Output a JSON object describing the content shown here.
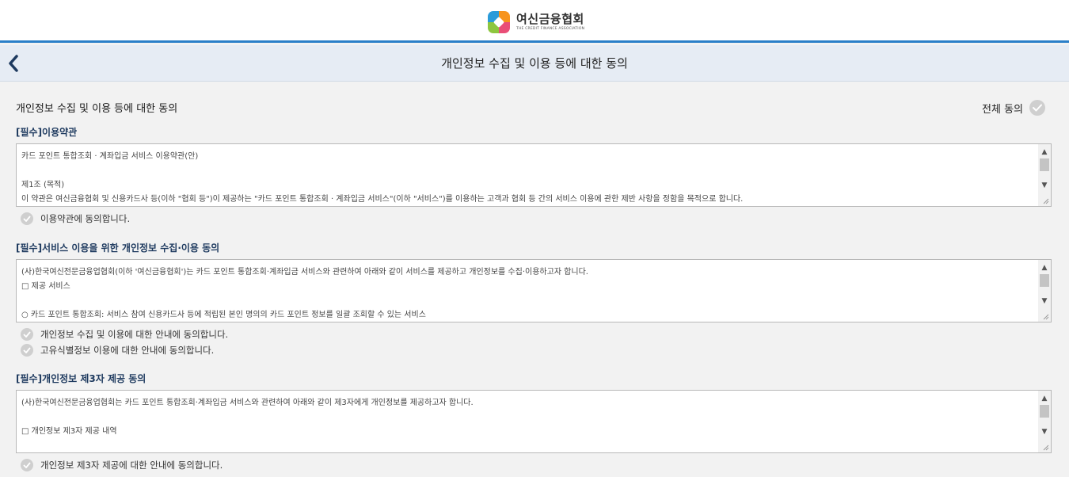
{
  "header": {
    "logo_ko": "여신금융협회",
    "logo_en": "THE CREDIT FINANCE ASSOCIATION"
  },
  "titlebar": {
    "title": "개인정보 수집 및 이용 등에 대한 동의"
  },
  "main": {
    "heading": "개인정보 수집 및 이용 등에 대한 동의",
    "all_agree_label": "전체 동의",
    "sections": [
      {
        "title": "[필수]이용약관",
        "text": "카드 포인트 통합조회 · 계좌입금 서비스 이용약관(안)\n\n제1조 (목적)\n이 약관은 여신금융협회 및 신용카드사 등(이하 \"협회 등\")이 제공하는 \"카드 포인트 통합조회 · 계좌입금 서비스\"(이하 \"서비스\")를 이용하는 고객과 협회 등 간의 서비스 이용에 관한 제반 사항을 정함을 목적으로 합니다.",
        "checks": [
          "이용약관에 동의합니다."
        ]
      },
      {
        "title": "[필수]서비스 이용을 위한 개인정보 수집·이용 동의",
        "text": "(사)한국여신전문금융업협회(이하 '여신금융협회')는 카드 포인트 통합조회·계좌입금 서비스와 관련하여 아래와 같이 서비스를 제공하고 개인정보를 수집·이용하고자 합니다.\n□ 제공 서비스\n\n○ 카드 포인트 통합조회: 서비스 참여 신용카드사 등에 적립된 본인 명의의 카드 포인트 정보를 일괄 조회할 수 있는 서비스",
        "checks": [
          "개인정보 수집 및 이용에 대한 안내에 동의합니다.",
          "고유식별정보 이용에 대한 안내에 동의합니다."
        ]
      },
      {
        "title": "[필수]개인정보 제3자 제공 동의",
        "text": "(사)한국여신전문금융업협회는 카드 포인트 통합조회·계좌입금 서비스와 관련하여 아래와 같이 제3자에게 개인정보를 제공하고자 합니다.\n\n□ 개인정보 제3자 제공 내역",
        "checks": [
          "개인정보 제3자 제공에 대한 안내에 동의합니다."
        ]
      }
    ]
  },
  "icons": {
    "back": "chevron-left-icon",
    "check": "check-circle-icon",
    "scroll_up": "scroll-up-icon",
    "scroll_down": "scroll-down-icon",
    "resize": "resize-grip-icon"
  },
  "colors": {
    "accent": "#2b7fc8",
    "title_bar_bg": "#e6ecf4",
    "section_title": "#1e3a5f",
    "check_bg": "#cfcfcf",
    "page_bg": "#f2f2f2"
  }
}
